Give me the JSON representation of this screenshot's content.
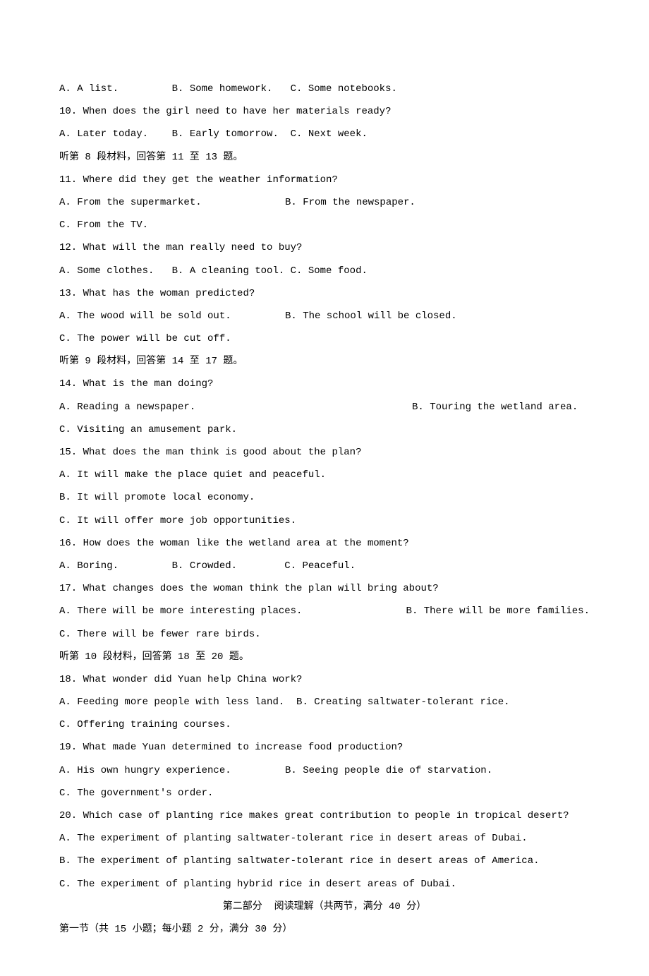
{
  "lines": [
    {
      "type": "single",
      "text": "A. A list.         B. Some homework.   C. Some notebooks."
    },
    {
      "type": "single",
      "text": "10. When does the girl need to have her materials ready?"
    },
    {
      "type": "single",
      "text": "A. Later today.    B. Early tomorrow.  C. Next week."
    },
    {
      "type": "single",
      "text": "听第 8 段材料，回答第 11 至 13 题。"
    },
    {
      "type": "single",
      "text": "11. Where did they get the weather information?"
    },
    {
      "type": "two",
      "left": "A. From the supermarket.",
      "right": "B. From the newspaper.",
      "leftWidth": "320px"
    },
    {
      "type": "single",
      "text": "C. From the TV."
    },
    {
      "type": "single",
      "text": "12. What will the man really need to buy?"
    },
    {
      "type": "single",
      "text": "A. Some clothes.   B. A cleaning tool. C. Some food."
    },
    {
      "type": "single",
      "text": "13. What has the woman predicted?"
    },
    {
      "type": "two",
      "left": "A. The wood will be sold out.",
      "right": "B. The school will be closed.",
      "leftWidth": "320px"
    },
    {
      "type": "single",
      "text": "C. The power will be cut off."
    },
    {
      "type": "single",
      "text": "听第 9 段材料，回答第 14 至 17 题。"
    },
    {
      "type": "single",
      "text": "14. What is the man doing?"
    },
    {
      "type": "two",
      "left": "A. Reading a newspaper.",
      "right": "B. Touring the wetland area.",
      "leftWidth": "500px"
    },
    {
      "type": "single",
      "text": "C. Visiting an amusement park."
    },
    {
      "type": "single",
      "text": "15. What does the man think is good about the plan?"
    },
    {
      "type": "single",
      "text": "A. It will make the place quiet and peaceful."
    },
    {
      "type": "single",
      "text": "B. It will promote local economy."
    },
    {
      "type": "single",
      "text": "C. It will offer more job opportunities."
    },
    {
      "type": "single",
      "text": "16. How does the woman like the wetland area at the moment?"
    },
    {
      "type": "single",
      "text": "A. Boring.         B. Crowded.        C. Peaceful."
    },
    {
      "type": "single",
      "text": "17. What changes does the woman think the plan will bring about?"
    },
    {
      "type": "two",
      "left": "A. There will be more interesting places.",
      "right": "B. There will be more families.",
      "leftWidth": "500px"
    },
    {
      "type": "single",
      "text": "C. There will be fewer rare birds."
    },
    {
      "type": "single",
      "text": "听第 10 段材料，回答第 18 至 20 题。"
    },
    {
      "type": "single",
      "text": "18. What wonder did Yuan help China work?"
    },
    {
      "type": "single",
      "text": "A. Feeding more people with less land.  B. Creating saltwater-tolerant rice."
    },
    {
      "type": "single",
      "text": "C. Offering training courses."
    },
    {
      "type": "single",
      "text": "19. What made Yuan determined to increase food production?"
    },
    {
      "type": "two",
      "left": "A. His own hungry experience.",
      "right": "B. Seeing people die of starvation.",
      "leftWidth": "320px"
    },
    {
      "type": "single",
      "text": "C. The government's order."
    },
    {
      "type": "single",
      "text": "20. Which case of planting rice makes great contribution to people in tropical desert?"
    },
    {
      "type": "single",
      "text": "A. The experiment of planting saltwater-tolerant rice in desert areas of Dubai."
    },
    {
      "type": "single",
      "text": "B. The experiment of planting saltwater-tolerant rice in desert areas of America."
    },
    {
      "type": "single",
      "text": "C. The experiment of planting hybrid rice in desert areas of Dubai."
    },
    {
      "type": "center",
      "text": "第二部分  阅读理解（共两节，满分 40 分）"
    },
    {
      "type": "single",
      "text": "第一节（共 15 小题；每小题 2 分，满分 30 分）"
    }
  ]
}
